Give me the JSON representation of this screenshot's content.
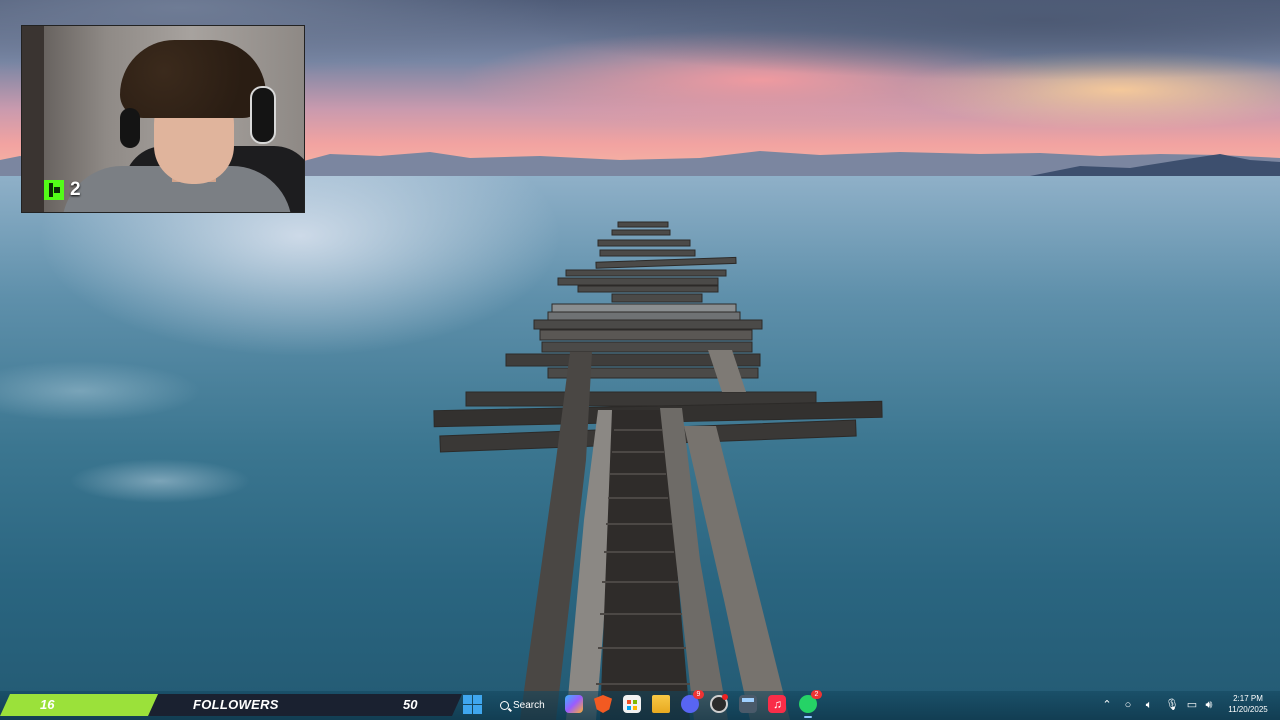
{
  "webcam": {
    "platform_icon": "kick-logo-icon",
    "sub_count": "2",
    "accent": "#53fc18"
  },
  "follower_goal": {
    "current": "16",
    "label": "FOLLOWERS",
    "goal": "50",
    "progress": 0.32,
    "bar_color": "#9be13a"
  },
  "taskbar": {
    "search_label": "Search",
    "apps": [
      {
        "name": "copilot",
        "icon": "copilot-icon"
      },
      {
        "name": "brave",
        "icon": "brave-browser-icon"
      },
      {
        "name": "microsoft-store",
        "icon": "store-icon"
      },
      {
        "name": "file-explorer",
        "icon": "folder-icon"
      },
      {
        "name": "discord",
        "icon": "discord-icon",
        "badge": "9"
      },
      {
        "name": "obs",
        "icon": "record-icon"
      },
      {
        "name": "calculator",
        "icon": "calculator-icon"
      },
      {
        "name": "apple-music",
        "icon": "music-icon"
      },
      {
        "name": "whatsapp",
        "icon": "whatsapp-icon",
        "badge": "2"
      }
    ],
    "tray": [
      "chevron-up-icon",
      "copilot-tray-icon",
      "speaker-icon",
      "microphone-icon",
      "network-icon",
      "volume-icon"
    ],
    "time": "2:17 PM",
    "date": "11/20/2025"
  }
}
